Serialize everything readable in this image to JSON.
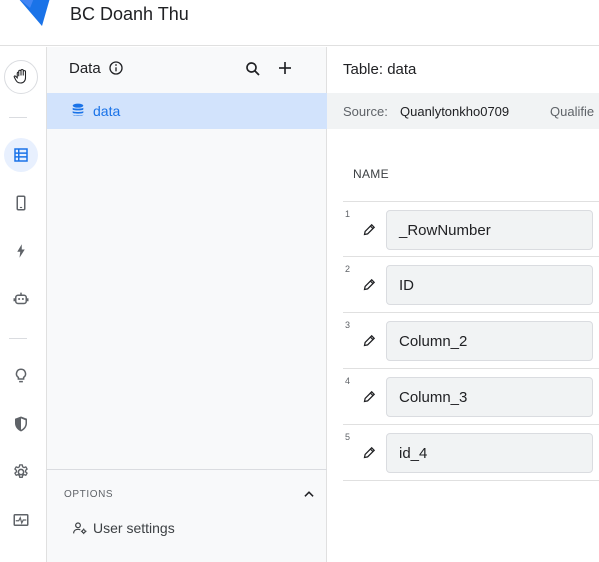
{
  "app": {
    "title": "BC Doanh Thu",
    "brand_color": "#1a73e8"
  },
  "rail": {
    "items": [
      {
        "icon": "profile-hand-icon",
        "active": false
      },
      {
        "icon": "table-icon",
        "active": true
      },
      {
        "icon": "mobile-icon",
        "active": false
      },
      {
        "icon": "bolt-icon",
        "active": false
      },
      {
        "icon": "bot-icon",
        "active": false
      },
      {
        "icon": "lightbulb-icon",
        "active": false
      },
      {
        "icon": "shield-icon",
        "active": false
      },
      {
        "icon": "gear-icon",
        "active": false
      },
      {
        "icon": "monitor-icon",
        "active": false
      }
    ]
  },
  "data_panel": {
    "title": "Data",
    "items": [
      {
        "label": "data",
        "icon": "database-icon",
        "selected": true
      }
    ],
    "options": {
      "label": "OPTIONS",
      "user_settings": "User settings"
    }
  },
  "main": {
    "title": "Table: data",
    "source_label": "Source:",
    "source_value": "Quanlytonkho0709",
    "qualifier_label": "Qualifie",
    "column_header": "NAME",
    "rows": [
      {
        "num": "1",
        "name": "_RowNumber"
      },
      {
        "num": "2",
        "name": "ID"
      },
      {
        "num": "3",
        "name": "Column_2"
      },
      {
        "num": "4",
        "name": "Column_3"
      },
      {
        "num": "5",
        "name": "id_4"
      }
    ]
  }
}
